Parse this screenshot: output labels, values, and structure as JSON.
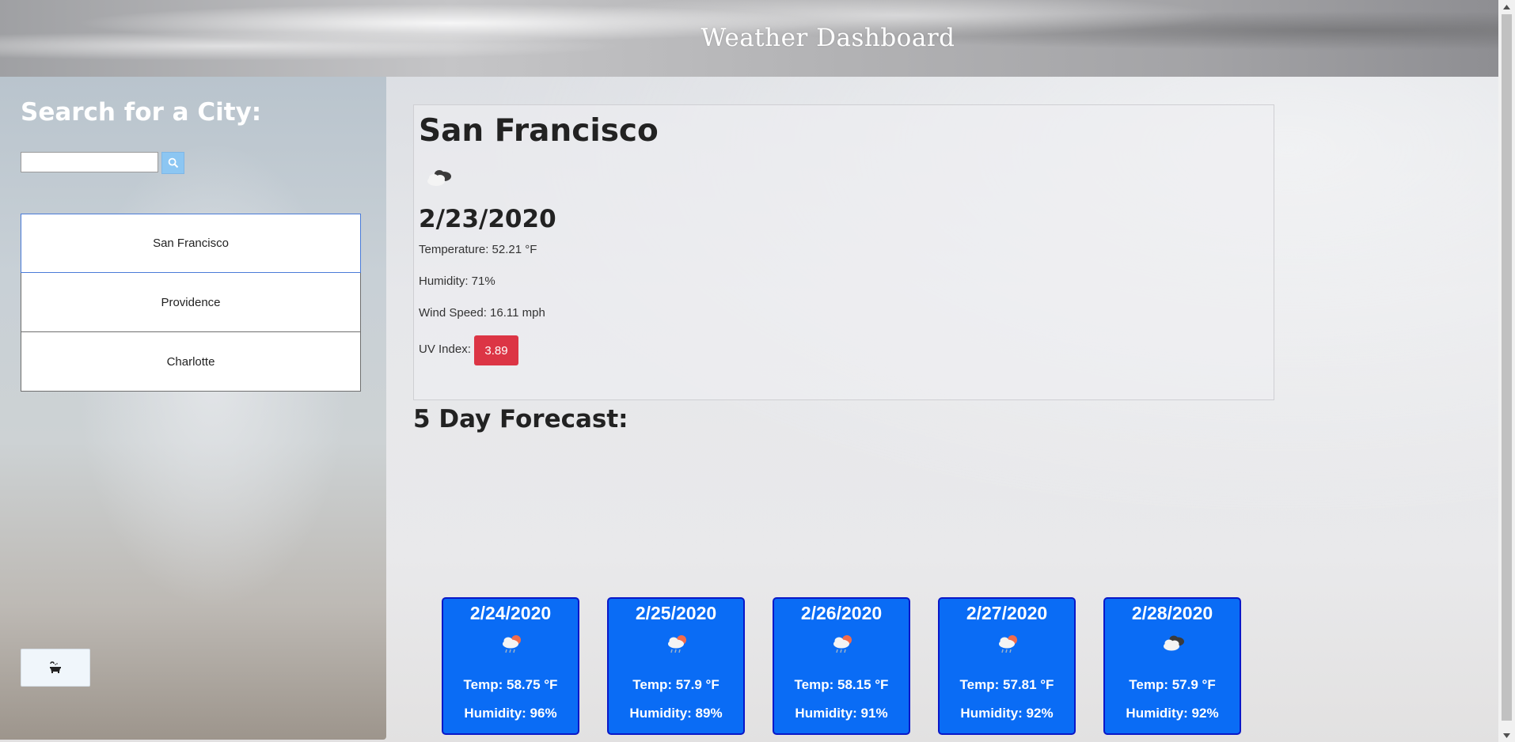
{
  "header": {
    "title": "Weather Dashboard"
  },
  "sidebar": {
    "title": "Search for a City:",
    "search": {
      "value": "",
      "placeholder": ""
    },
    "search_icon": "search-icon",
    "cities": [
      {
        "label": "San Francisco",
        "active": true
      },
      {
        "label": "Providence",
        "active": false
      },
      {
        "label": "Charlotte",
        "active": false
      }
    ],
    "clear_icon": "bathtub-icon"
  },
  "current": {
    "city": "San Francisco",
    "icon": "broken-clouds-icon",
    "date": "2/23/2020",
    "temperature": "Temperature: 52.21 °F",
    "humidity": "Humidity: 71%",
    "wind": "Wind Speed: 16.11 mph",
    "uv_label": "UV Index:",
    "uv_value": "3.89",
    "uv_color": "#dc3545"
  },
  "forecast": {
    "title": "5 Day Forecast:",
    "card_color": "#0a6cf5",
    "days": [
      {
        "date": "2/24/2020",
        "icon": "rain-sun-icon",
        "temp": "Temp: 58.75 °F",
        "humidity": "Humidity: 96%"
      },
      {
        "date": "2/25/2020",
        "icon": "rain-sun-icon",
        "temp": "Temp: 57.9 °F",
        "humidity": "Humidity: 89%"
      },
      {
        "date": "2/26/2020",
        "icon": "rain-sun-icon",
        "temp": "Temp: 58.15 °F",
        "humidity": "Humidity: 91%"
      },
      {
        "date": "2/27/2020",
        "icon": "rain-sun-icon",
        "temp": "Temp: 57.81 °F",
        "humidity": "Humidity: 92%"
      },
      {
        "date": "2/28/2020",
        "icon": "broken-clouds-icon",
        "temp": "Temp: 57.9 °F",
        "humidity": "Humidity: 92%"
      }
    ]
  }
}
